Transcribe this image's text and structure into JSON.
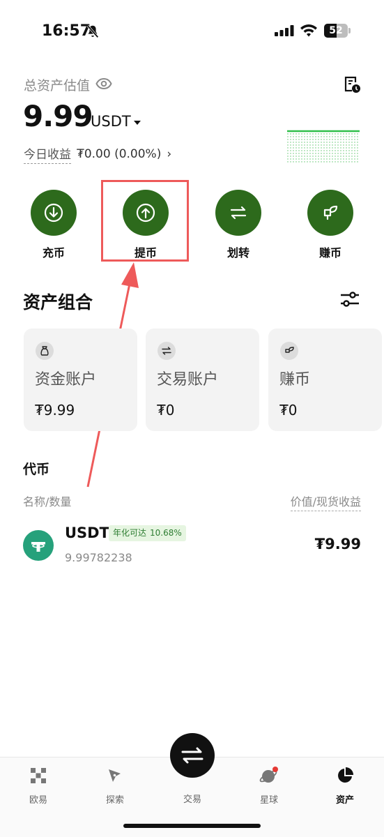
{
  "status_bar": {
    "time": "16:57",
    "battery": "52",
    "battery_level": 0.52
  },
  "header": {
    "total_label": "总资产估值",
    "balance": "9.99",
    "currency": "USDT",
    "today_label": "今日收益",
    "today_value": "₮0.00 (0.00%)"
  },
  "actions": [
    {
      "label": "充币",
      "icon": "deposit-icon"
    },
    {
      "label": "提币",
      "icon": "withdraw-icon"
    },
    {
      "label": "划转",
      "icon": "transfer-icon"
    },
    {
      "label": "赚币",
      "icon": "earn-icon"
    }
  ],
  "portfolio": {
    "title": "资产组合",
    "cards": [
      {
        "title": "资金账户",
        "value": "₮9.99",
        "icon": "bag-icon"
      },
      {
        "title": "交易账户",
        "value": "₮0",
        "icon": "swap-icon"
      },
      {
        "title": "赚币",
        "value": "₮0",
        "icon": "earn-icon"
      }
    ]
  },
  "tokens": {
    "title": "代币",
    "col_left": "名称/数量",
    "col_right": "价值/现货收益",
    "rows": [
      {
        "name": "USDT",
        "apy_label": "年化可达",
        "apy_rate": "10.68%",
        "qty": "9.99782238",
        "value": "₮9.99",
        "icon": "tether-icon"
      }
    ]
  },
  "tab_bar": {
    "items": [
      {
        "label": "欧易",
        "icon": "okx-logo-icon"
      },
      {
        "label": "探索",
        "icon": "compass-icon"
      },
      {
        "label": "交易",
        "icon": "trade-icon"
      },
      {
        "label": "星球",
        "icon": "planet-icon"
      },
      {
        "label": "资产",
        "icon": "pie-chart-icon"
      }
    ],
    "active": "资产"
  },
  "colors": {
    "accent": "#2d6a1c",
    "highlight": "#ee5a5a",
    "tether": "#26a17b",
    "positive": "#2e7d32"
  }
}
